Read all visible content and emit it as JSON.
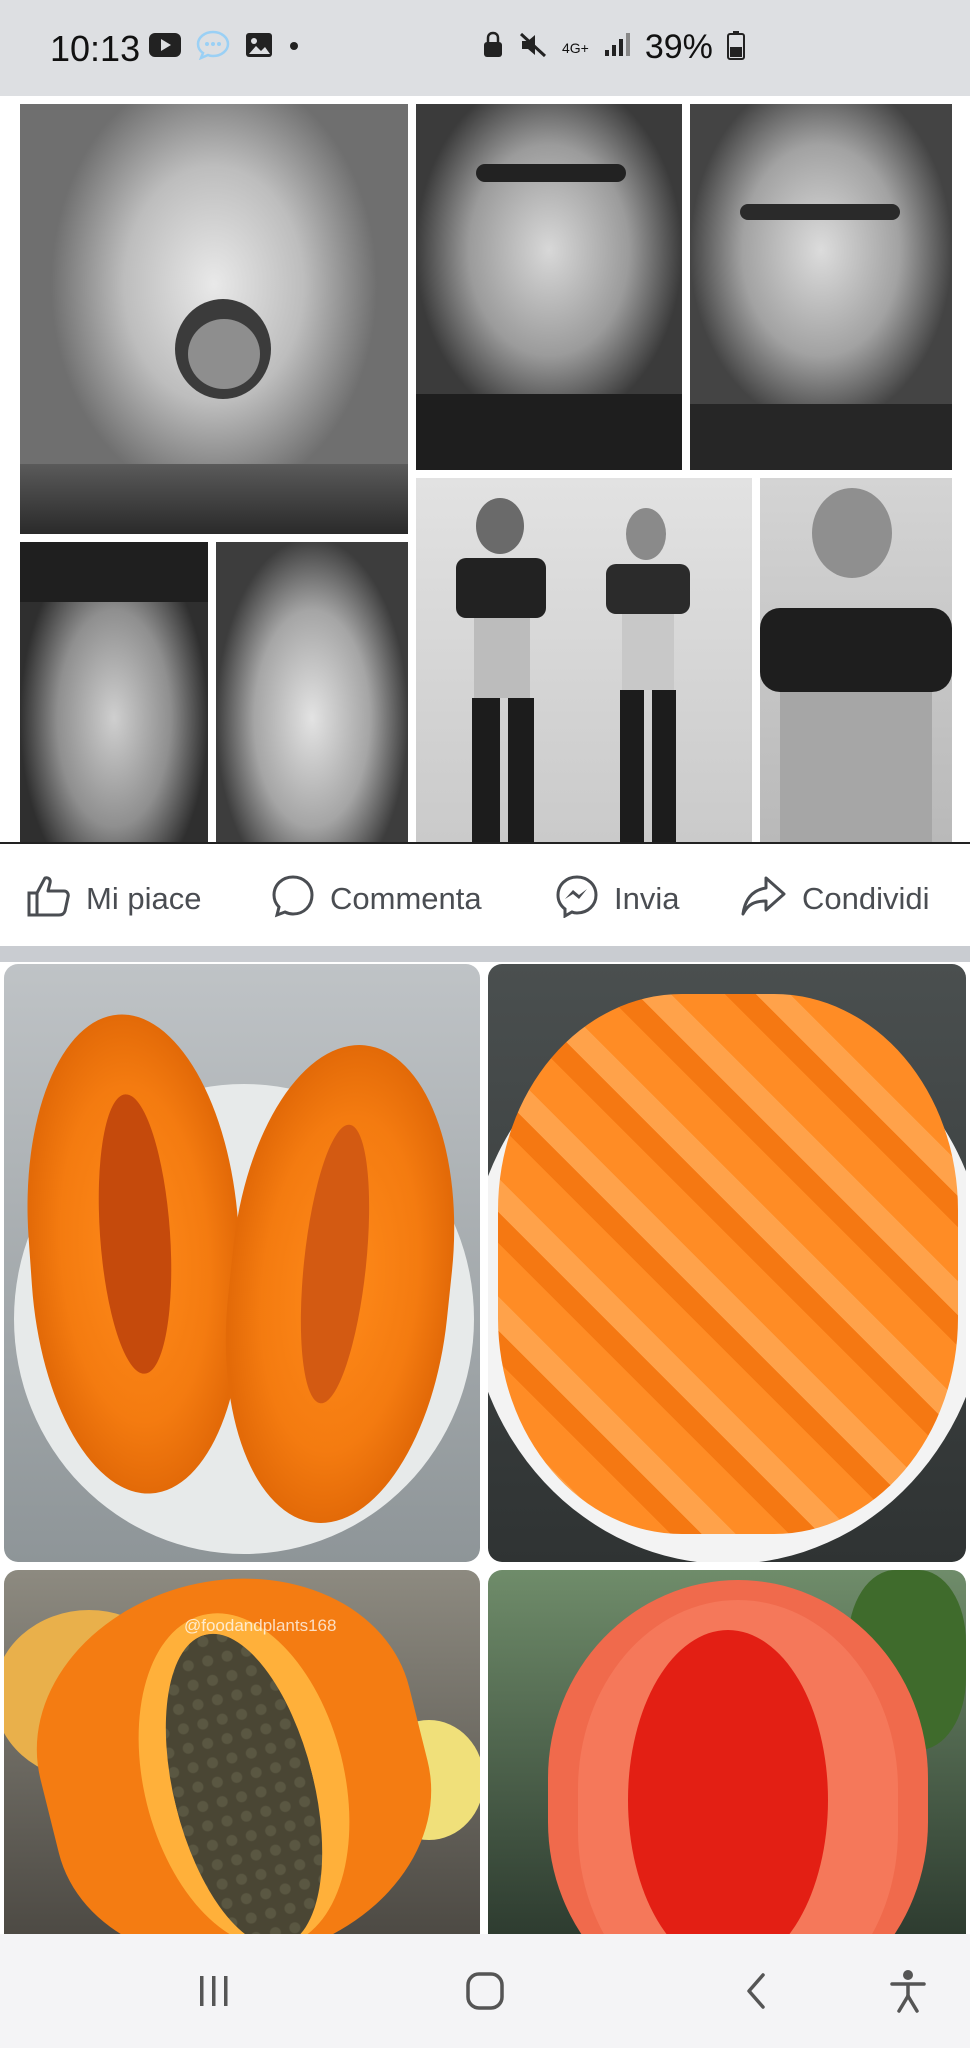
{
  "status_bar": {
    "time": "10:13",
    "network": "4G+",
    "battery": "39%",
    "icons": [
      "youtube-icon",
      "message-bubble-icon",
      "gallery-icon",
      "dot-icon",
      "lock-icon",
      "mute-icon",
      "signal-icon",
      "battery-icon"
    ]
  },
  "post1": {
    "image": "black-and-white-collage"
  },
  "actions": {
    "like_label": "Mi piace",
    "comment_label": "Commenta",
    "send_label": "Invia",
    "share_label": "Condividi"
  },
  "post2": {
    "image": "papaya-collage",
    "watermark": "@foodandplants168"
  },
  "nav_bar": {
    "icons": [
      "recent-apps-icon",
      "home-icon",
      "back-icon",
      "accessibility-icon"
    ]
  },
  "colors": {
    "status_bar_bg": "#dddfe2",
    "action_text": "#4a4d52",
    "papaya_orange": "#f28a1e",
    "nav_bg": "#f4f4f6"
  }
}
